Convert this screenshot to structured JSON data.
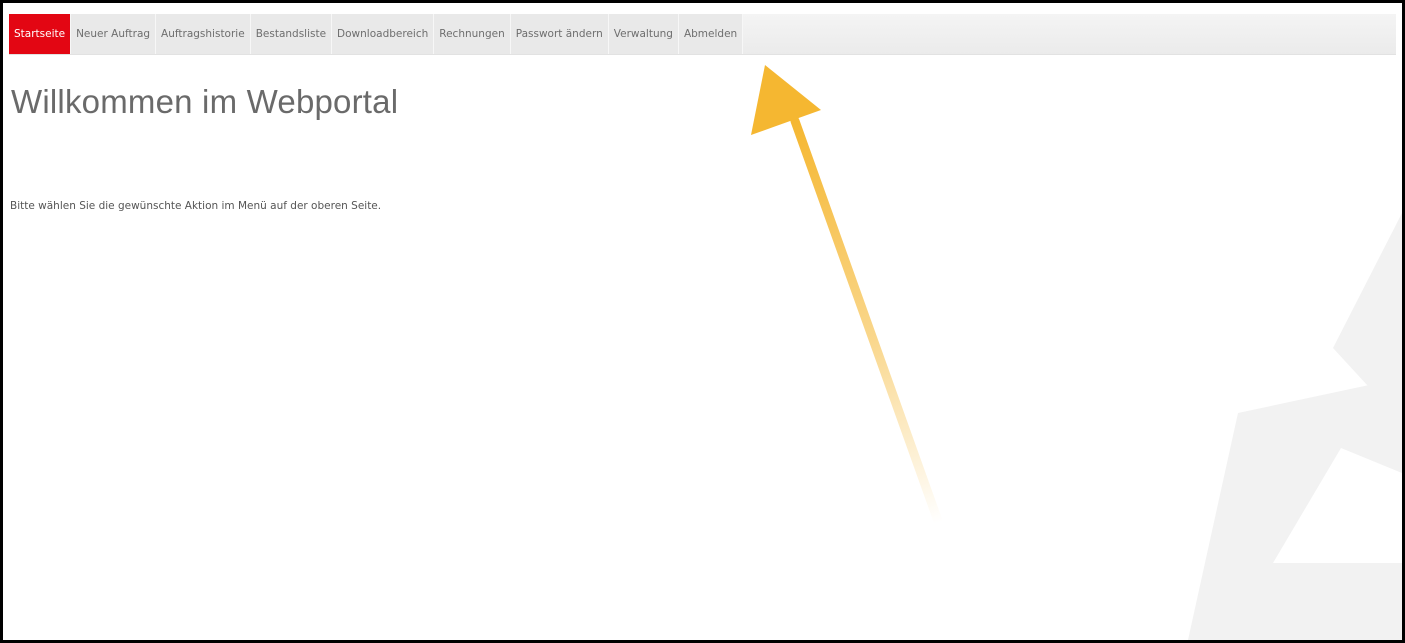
{
  "nav": {
    "items": [
      {
        "label": "Startseite",
        "active": true
      },
      {
        "label": "Neuer Auftrag",
        "active": false
      },
      {
        "label": "Auftragshistorie",
        "active": false
      },
      {
        "label": "Bestandsliste",
        "active": false
      },
      {
        "label": "Downloadbereich",
        "active": false
      },
      {
        "label": "Rechnungen",
        "active": false
      },
      {
        "label": "Passwort ändern",
        "active": false
      },
      {
        "label": "Verwaltung",
        "active": false
      },
      {
        "label": "Abmelden",
        "active": false
      }
    ]
  },
  "main": {
    "title": "Willkommen im Webportal",
    "intro": "Bitte wählen Sie die gewünschte Aktion im Menü auf der oberen Seite."
  },
  "colors": {
    "active_tab": "#e30613",
    "nav_bg": "#e9e9e9",
    "annotation_arrow": "#f5b731"
  }
}
